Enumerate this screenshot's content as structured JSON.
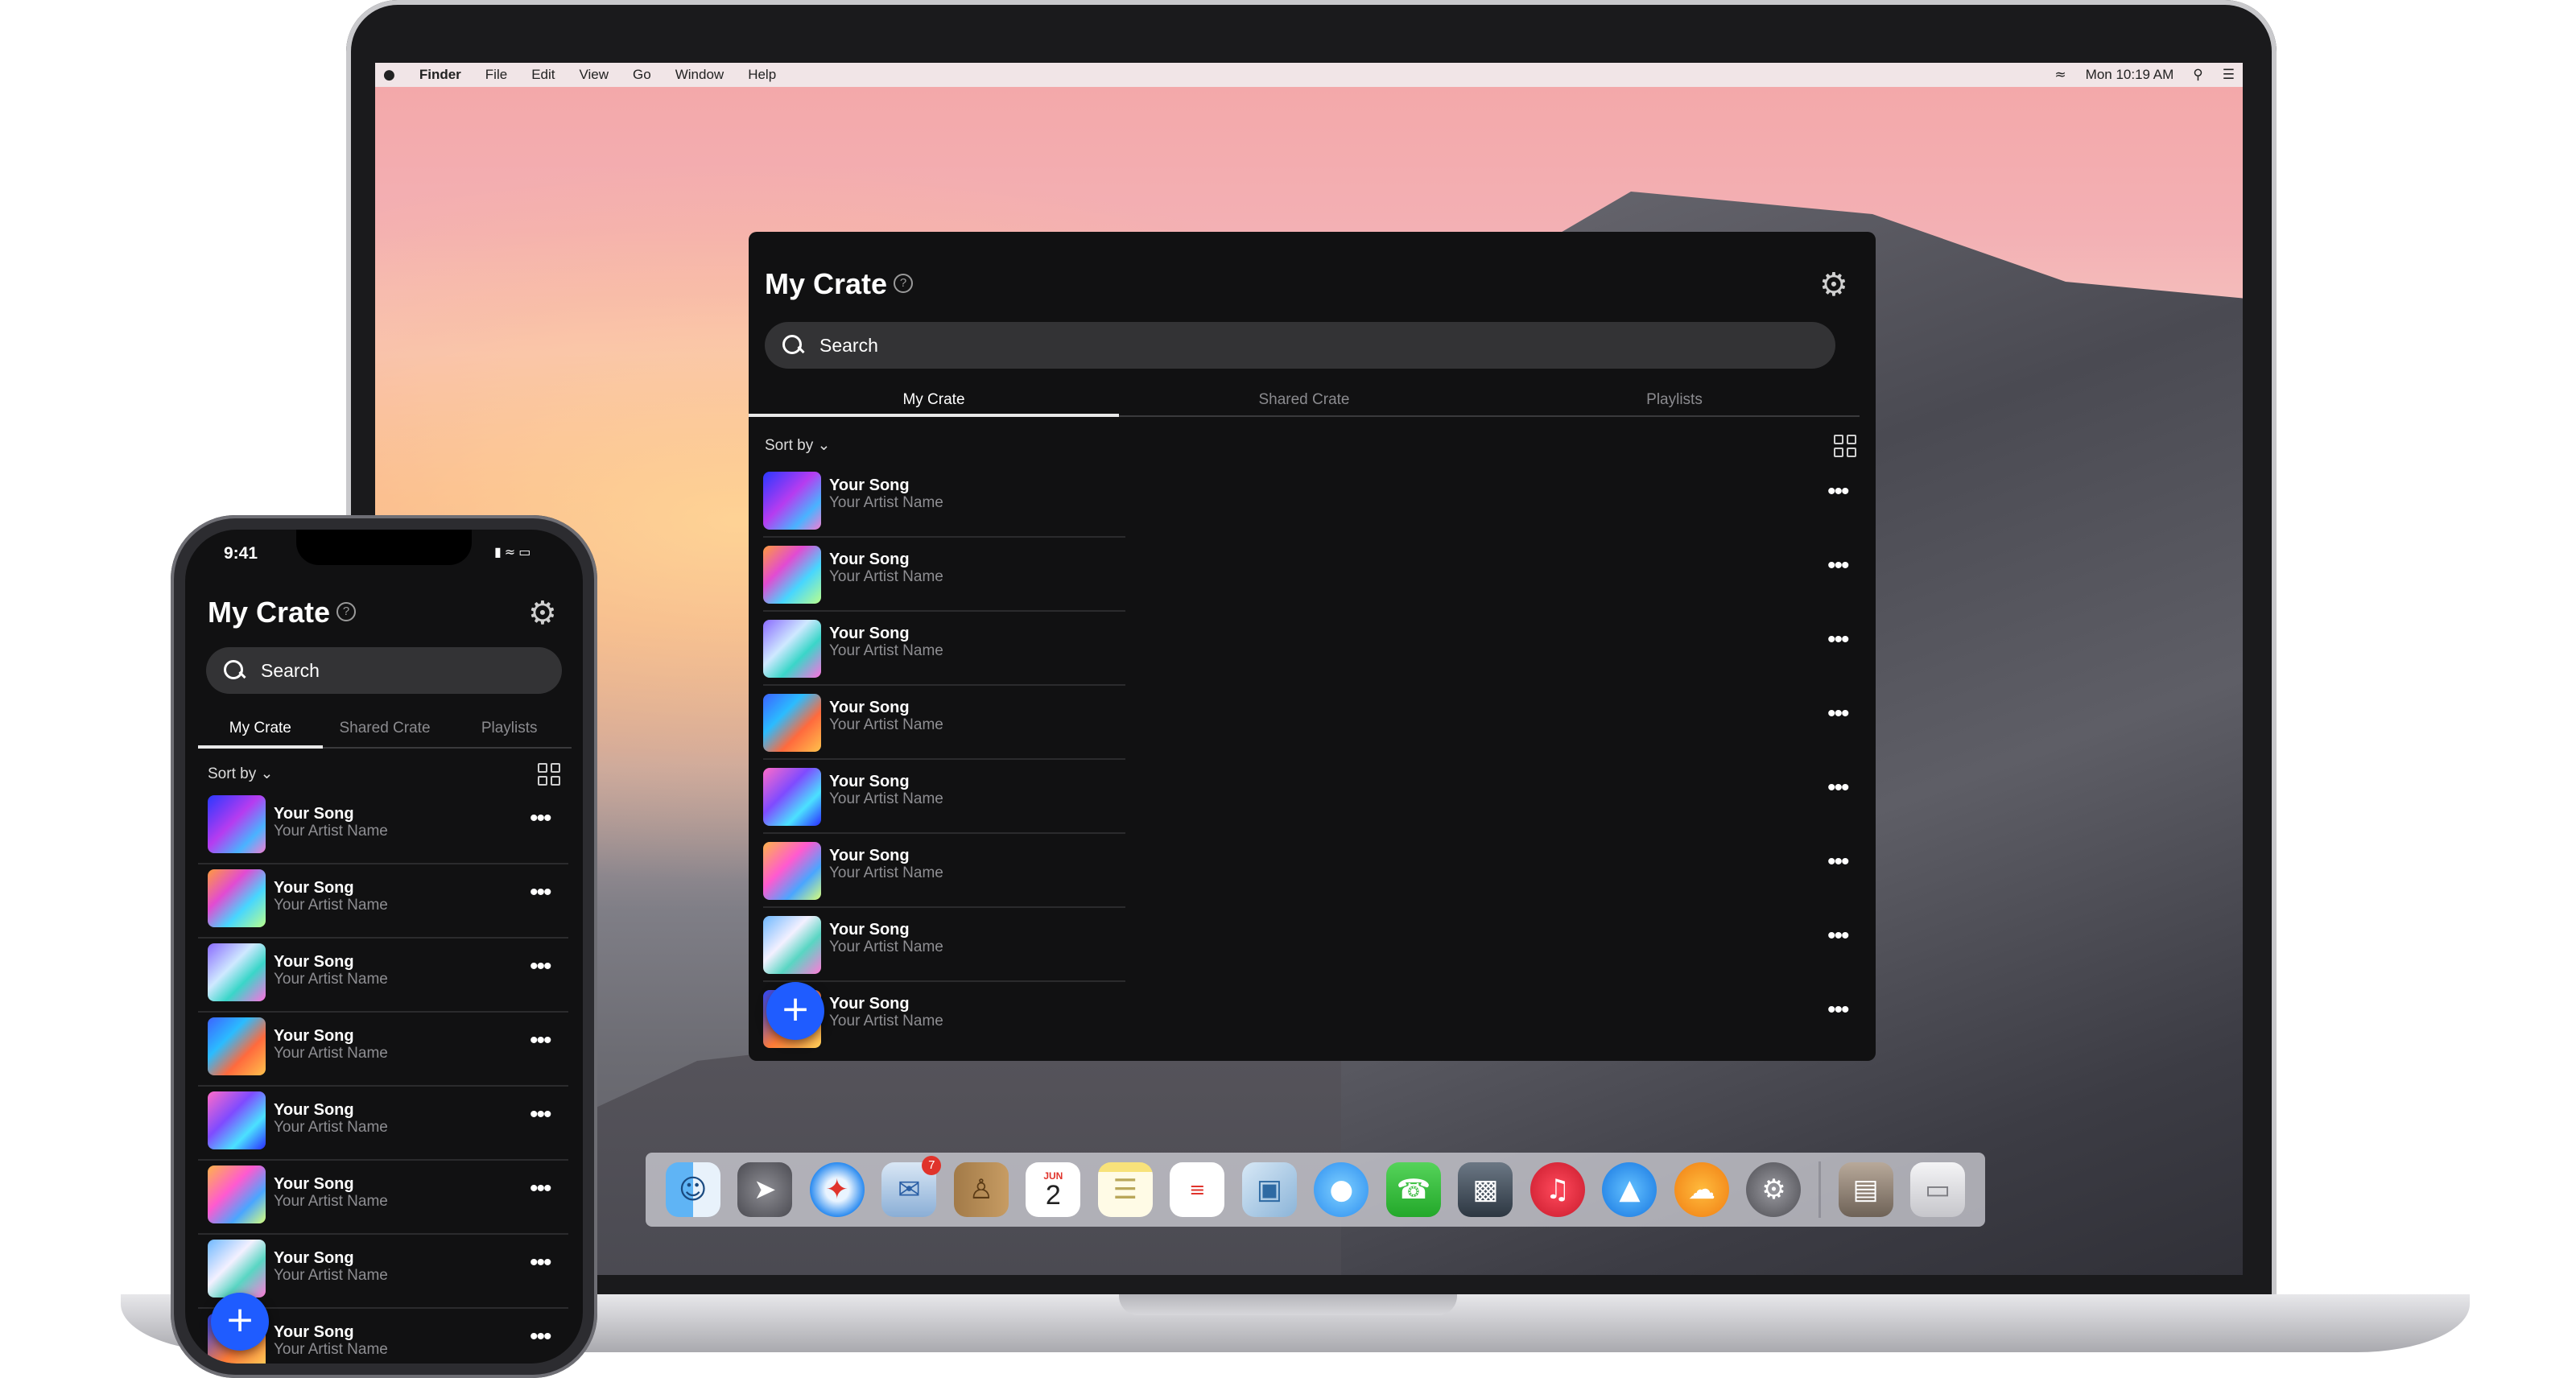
{
  "desktop": {
    "menubar": {
      "items": [
        "Finder",
        "File",
        "Edit",
        "View",
        "Go",
        "Window",
        "Help"
      ],
      "clock": "Mon 10:19 AM"
    },
    "app": {
      "title": "My Crate",
      "search_placeholder": "Search",
      "tabs": [
        "My Crate",
        "Shared Crate",
        "Playlists"
      ],
      "active_tab": "My Crate",
      "sort_label": "Sort by",
      "songs": [
        {
          "title": "Your Song",
          "artist": "Your Artist Name"
        },
        {
          "title": "Your Song",
          "artist": "Your Artist Name"
        },
        {
          "title": "Your Song",
          "artist": "Your Artist Name"
        },
        {
          "title": "Your Song",
          "artist": "Your Artist Name"
        },
        {
          "title": "Your Song",
          "artist": "Your Artist Name"
        },
        {
          "title": "Your Song",
          "artist": "Your Artist Name"
        },
        {
          "title": "Your Song",
          "artist": "Your Artist Name"
        },
        {
          "title": "Your Song",
          "artist": "Your Artist Name"
        }
      ],
      "fab_label": "+"
    },
    "dock": {
      "calendar_month": "JUN",
      "calendar_day": "2",
      "badge_count": "7"
    }
  },
  "phone": {
    "status_time": "9:41",
    "app": {
      "title": "My Crate",
      "search_placeholder": "Search",
      "tabs": [
        "My Crate",
        "Shared Crate",
        "Playlists"
      ],
      "active_tab": "My Crate",
      "sort_label": "Sort by",
      "songs": [
        {
          "title": "Your Song",
          "artist": "Your Artist Name"
        },
        {
          "title": "Your Song",
          "artist": "Your Artist Name"
        },
        {
          "title": "Your Song",
          "artist": "Your Artist Name"
        },
        {
          "title": "Your Song",
          "artist": "Your Artist Name"
        },
        {
          "title": "Your Song",
          "artist": "Your Artist Name"
        },
        {
          "title": "Your Song",
          "artist": "Your Artist Name"
        },
        {
          "title": "Your Song",
          "artist": "Your Artist Name"
        },
        {
          "title": "Your Song",
          "artist": "Your Artist Name"
        }
      ],
      "fab_label": "+"
    }
  },
  "colors": {
    "app_background": "#111112",
    "search_background": "#333335",
    "fab_blue": "#1f5cff",
    "muted_text": "#8e8e92"
  }
}
